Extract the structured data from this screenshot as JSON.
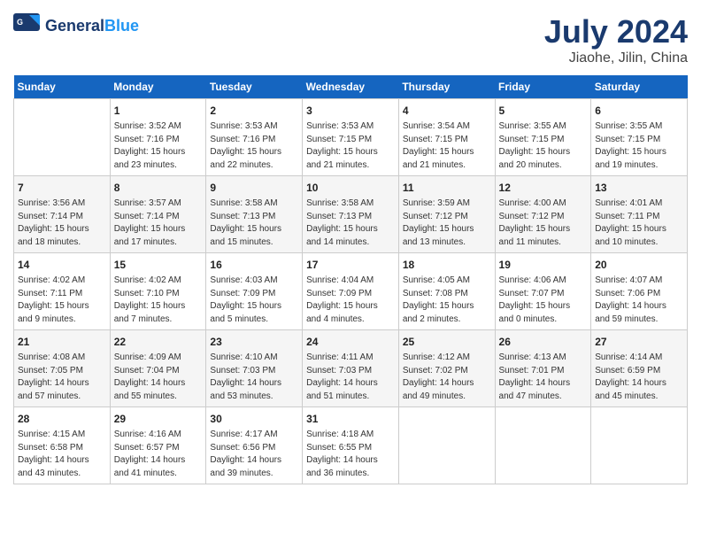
{
  "header": {
    "logo_general": "General",
    "logo_blue": "Blue",
    "month_title": "July 2024",
    "location": "Jiaohe, Jilin, China"
  },
  "calendar": {
    "days_of_week": [
      "Sunday",
      "Monday",
      "Tuesday",
      "Wednesday",
      "Thursday",
      "Friday",
      "Saturday"
    ],
    "weeks": [
      [
        {
          "day": "",
          "info": ""
        },
        {
          "day": "1",
          "info": "Sunrise: 3:52 AM\nSunset: 7:16 PM\nDaylight: 15 hours\nand 23 minutes."
        },
        {
          "day": "2",
          "info": "Sunrise: 3:53 AM\nSunset: 7:16 PM\nDaylight: 15 hours\nand 22 minutes."
        },
        {
          "day": "3",
          "info": "Sunrise: 3:53 AM\nSunset: 7:15 PM\nDaylight: 15 hours\nand 21 minutes."
        },
        {
          "day": "4",
          "info": "Sunrise: 3:54 AM\nSunset: 7:15 PM\nDaylight: 15 hours\nand 21 minutes."
        },
        {
          "day": "5",
          "info": "Sunrise: 3:55 AM\nSunset: 7:15 PM\nDaylight: 15 hours\nand 20 minutes."
        },
        {
          "day": "6",
          "info": "Sunrise: 3:55 AM\nSunset: 7:15 PM\nDaylight: 15 hours\nand 19 minutes."
        }
      ],
      [
        {
          "day": "7",
          "info": "Sunrise: 3:56 AM\nSunset: 7:14 PM\nDaylight: 15 hours\nand 18 minutes."
        },
        {
          "day": "8",
          "info": "Sunrise: 3:57 AM\nSunset: 7:14 PM\nDaylight: 15 hours\nand 17 minutes."
        },
        {
          "day": "9",
          "info": "Sunrise: 3:58 AM\nSunset: 7:13 PM\nDaylight: 15 hours\nand 15 minutes."
        },
        {
          "day": "10",
          "info": "Sunrise: 3:58 AM\nSunset: 7:13 PM\nDaylight: 15 hours\nand 14 minutes."
        },
        {
          "day": "11",
          "info": "Sunrise: 3:59 AM\nSunset: 7:12 PM\nDaylight: 15 hours\nand 13 minutes."
        },
        {
          "day": "12",
          "info": "Sunrise: 4:00 AM\nSunset: 7:12 PM\nDaylight: 15 hours\nand 11 minutes."
        },
        {
          "day": "13",
          "info": "Sunrise: 4:01 AM\nSunset: 7:11 PM\nDaylight: 15 hours\nand 10 minutes."
        }
      ],
      [
        {
          "day": "14",
          "info": "Sunrise: 4:02 AM\nSunset: 7:11 PM\nDaylight: 15 hours\nand 9 minutes."
        },
        {
          "day": "15",
          "info": "Sunrise: 4:02 AM\nSunset: 7:10 PM\nDaylight: 15 hours\nand 7 minutes."
        },
        {
          "day": "16",
          "info": "Sunrise: 4:03 AM\nSunset: 7:09 PM\nDaylight: 15 hours\nand 5 minutes."
        },
        {
          "day": "17",
          "info": "Sunrise: 4:04 AM\nSunset: 7:09 PM\nDaylight: 15 hours\nand 4 minutes."
        },
        {
          "day": "18",
          "info": "Sunrise: 4:05 AM\nSunset: 7:08 PM\nDaylight: 15 hours\nand 2 minutes."
        },
        {
          "day": "19",
          "info": "Sunrise: 4:06 AM\nSunset: 7:07 PM\nDaylight: 15 hours\nand 0 minutes."
        },
        {
          "day": "20",
          "info": "Sunrise: 4:07 AM\nSunset: 7:06 PM\nDaylight: 14 hours\nand 59 minutes."
        }
      ],
      [
        {
          "day": "21",
          "info": "Sunrise: 4:08 AM\nSunset: 7:05 PM\nDaylight: 14 hours\nand 57 minutes."
        },
        {
          "day": "22",
          "info": "Sunrise: 4:09 AM\nSunset: 7:04 PM\nDaylight: 14 hours\nand 55 minutes."
        },
        {
          "day": "23",
          "info": "Sunrise: 4:10 AM\nSunset: 7:03 PM\nDaylight: 14 hours\nand 53 minutes."
        },
        {
          "day": "24",
          "info": "Sunrise: 4:11 AM\nSunset: 7:03 PM\nDaylight: 14 hours\nand 51 minutes."
        },
        {
          "day": "25",
          "info": "Sunrise: 4:12 AM\nSunset: 7:02 PM\nDaylight: 14 hours\nand 49 minutes."
        },
        {
          "day": "26",
          "info": "Sunrise: 4:13 AM\nSunset: 7:01 PM\nDaylight: 14 hours\nand 47 minutes."
        },
        {
          "day": "27",
          "info": "Sunrise: 4:14 AM\nSunset: 6:59 PM\nDaylight: 14 hours\nand 45 minutes."
        }
      ],
      [
        {
          "day": "28",
          "info": "Sunrise: 4:15 AM\nSunset: 6:58 PM\nDaylight: 14 hours\nand 43 minutes."
        },
        {
          "day": "29",
          "info": "Sunrise: 4:16 AM\nSunset: 6:57 PM\nDaylight: 14 hours\nand 41 minutes."
        },
        {
          "day": "30",
          "info": "Sunrise: 4:17 AM\nSunset: 6:56 PM\nDaylight: 14 hours\nand 39 minutes."
        },
        {
          "day": "31",
          "info": "Sunrise: 4:18 AM\nSunset: 6:55 PM\nDaylight: 14 hours\nand 36 minutes."
        },
        {
          "day": "",
          "info": ""
        },
        {
          "day": "",
          "info": ""
        },
        {
          "day": "",
          "info": ""
        }
      ]
    ]
  }
}
